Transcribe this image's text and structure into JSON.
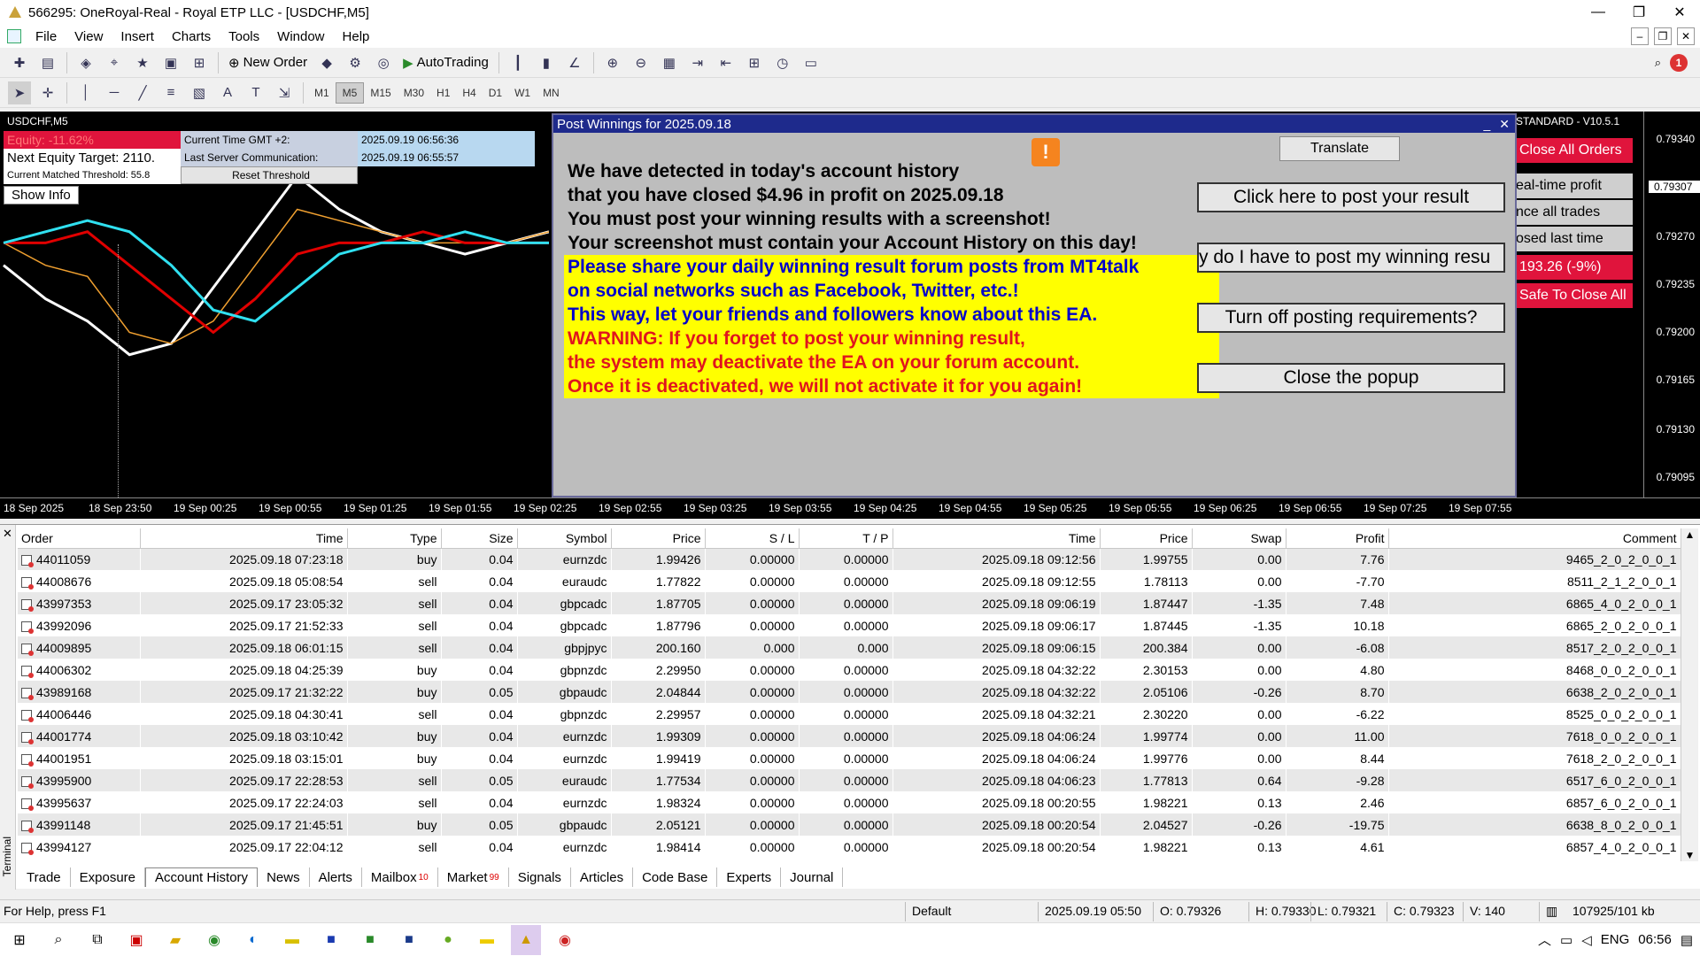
{
  "window": {
    "title": "566295: OneRoyal-Real - Royal ETP LLC - [USDCHF,M5]"
  },
  "menu": [
    "File",
    "View",
    "Insert",
    "Charts",
    "Tools",
    "Window",
    "Help"
  ],
  "toolbar": {
    "new_order": "New Order",
    "autotrading": "AutoTrading",
    "notif_count": "1"
  },
  "timeframes": [
    {
      "label": "M1",
      "active": false
    },
    {
      "label": "M5",
      "active": true
    },
    {
      "label": "M15",
      "active": false
    },
    {
      "label": "M30",
      "active": false
    },
    {
      "label": "H1",
      "active": false
    },
    {
      "label": "H4",
      "active": false
    },
    {
      "label": "D1",
      "active": false
    },
    {
      "label": "W1",
      "active": false
    },
    {
      "label": "MN",
      "active": false
    }
  ],
  "chart": {
    "symbol_label": "USDCHF,M5",
    "price_ticks": [
      "0.79340",
      "0.79270",
      "0.79235",
      "0.79200",
      "0.79165",
      "0.79130",
      "0.79095"
    ],
    "current_price": "0.79307",
    "time_ticks": [
      "18 Sep 2025",
      "18 Sep 23:50",
      "19 Sep 00:25",
      "19 Sep 00:55",
      "19 Sep 01:25",
      "19 Sep 01:55",
      "19 Sep 02:25",
      "19 Sep 02:55",
      "19 Sep 03:25",
      "19 Sep 03:55",
      "19 Sep 04:25",
      "19 Sep 04:55",
      "19 Sep 05:25",
      "19 Sep 05:55",
      "19 Sep 06:25",
      "19 Sep 06:55",
      "19 Sep 07:25",
      "19 Sep 07:55"
    ]
  },
  "info_panel": {
    "equity": "Equity: -11.62%",
    "next_target": "Next Equity Target: 2110.",
    "threshold": "Current Matched Threshold: 55.8",
    "gmt_label": "Current Time GMT +2:",
    "gmt_value": "2025.09.19 06:56:36",
    "server_label": "Last Server Communication:",
    "server_value": "2025.09.19 06:55:57",
    "reset": "Reset Threshold",
    "show_info": "Show Info"
  },
  "ea_panel": {
    "title": "STANDARD - V10.5.1",
    "close_all": "Close All Orders",
    "realtime": "eal-time profit",
    "balance": "nce all trades",
    "closed": "osed last time",
    "pnl": "193.26 (-9%)",
    "safe": "Safe To Close All"
  },
  "popup": {
    "title": "Post Winnings for 2025.09.18",
    "translate": "Translate",
    "lines": [
      {
        "text": "We have detected in today's account history",
        "style": "plain"
      },
      {
        "text": "that you have closed $4.96 in profit on 2025.09.18",
        "style": "plain"
      },
      {
        "text": "You must post your winning results with a screenshot!",
        "style": "plain"
      },
      {
        "text": "Your screenshot must contain your Account History on this day!",
        "style": "plain"
      },
      {
        "text": "Please share your daily winning result forum posts from MT4talk",
        "style": "yb"
      },
      {
        "text": "on social networks such as Facebook, Twitter, etc.!",
        "style": "yb"
      },
      {
        "text": "This way, let your friends and followers know about this EA.",
        "style": "yb"
      },
      {
        "text": "WARNING: If you forget to post your winning result,",
        "style": "yr"
      },
      {
        "text": "the system may deactivate the EA on your forum account.",
        "style": "yr"
      },
      {
        "text": "Once it is deactivated, we will not activate it for you again!",
        "style": "yr"
      }
    ],
    "buttons": {
      "post": "Click here to post your result",
      "why": "y do I have to post my winning resu",
      "turn_off": "Turn off posting requirements?",
      "close": "Close the popup"
    }
  },
  "terminal": {
    "side_label": "Terminal",
    "columns": [
      "Order",
      "Time",
      "Type",
      "Size",
      "Symbol",
      "Price",
      "S / L",
      "T / P",
      "Time",
      "Price",
      "Swap",
      "Profit",
      "Comment"
    ],
    "rows": [
      [
        "44011059",
        "2025.09.18 07:23:18",
        "buy",
        "0.04",
        "eurnzdc",
        "1.99426",
        "0.00000",
        "0.00000",
        "2025.09.18 09:12:56",
        "1.99755",
        "0.00",
        "7.76",
        "9465_2_0_2_0_0_1"
      ],
      [
        "44008676",
        "2025.09.18 05:08:54",
        "sell",
        "0.04",
        "euraudc",
        "1.77822",
        "0.00000",
        "0.00000",
        "2025.09.18 09:12:55",
        "1.78113",
        "0.00",
        "-7.70",
        "8511_2_1_2_0_0_1"
      ],
      [
        "43997353",
        "2025.09.17 23:05:32",
        "sell",
        "0.04",
        "gbpcadc",
        "1.87705",
        "0.00000",
        "0.00000",
        "2025.09.18 09:06:19",
        "1.87447",
        "-1.35",
        "7.48",
        "6865_4_0_2_0_0_1"
      ],
      [
        "43992096",
        "2025.09.17 21:52:33",
        "sell",
        "0.04",
        "gbpcadc",
        "1.87796",
        "0.00000",
        "0.00000",
        "2025.09.18 09:06:17",
        "1.87445",
        "-1.35",
        "10.18",
        "6865_2_0_2_0_0_1"
      ],
      [
        "44009895",
        "2025.09.18 06:01:15",
        "sell",
        "0.04",
        "gbpjpyc",
        "200.160",
        "0.000",
        "0.000",
        "2025.09.18 09:06:15",
        "200.384",
        "0.00",
        "-6.08",
        "8517_2_0_2_0_0_1"
      ],
      [
        "44006302",
        "2025.09.18 04:25:39",
        "buy",
        "0.04",
        "gbpnzdc",
        "2.29950",
        "0.00000",
        "0.00000",
        "2025.09.18 04:32:22",
        "2.30153",
        "0.00",
        "4.80",
        "8468_0_0_2_0_0_1"
      ],
      [
        "43989168",
        "2025.09.17 21:32:22",
        "buy",
        "0.05",
        "gbpaudc",
        "2.04844",
        "0.00000",
        "0.00000",
        "2025.09.18 04:32:22",
        "2.05106",
        "-0.26",
        "8.70",
        "6638_2_0_2_0_0_1"
      ],
      [
        "44006446",
        "2025.09.18 04:30:41",
        "sell",
        "0.04",
        "gbpnzdc",
        "2.29957",
        "0.00000",
        "0.00000",
        "2025.09.18 04:32:21",
        "2.30220",
        "0.00",
        "-6.22",
        "8525_0_0_2_0_0_1"
      ],
      [
        "44001774",
        "2025.09.18 03:10:42",
        "buy",
        "0.04",
        "eurnzdc",
        "1.99309",
        "0.00000",
        "0.00000",
        "2025.09.18 04:06:24",
        "1.99774",
        "0.00",
        "11.00",
        "7618_0_0_2_0_0_1"
      ],
      [
        "44001951",
        "2025.09.18 03:15:01",
        "buy",
        "0.04",
        "eurnzdc",
        "1.99419",
        "0.00000",
        "0.00000",
        "2025.09.18 04:06:24",
        "1.99776",
        "0.00",
        "8.44",
        "7618_2_0_2_0_0_1"
      ],
      [
        "43995900",
        "2025.09.17 22:28:53",
        "sell",
        "0.05",
        "euraudc",
        "1.77534",
        "0.00000",
        "0.00000",
        "2025.09.18 04:06:23",
        "1.77813",
        "0.64",
        "-9.28",
        "6517_6_0_2_0_0_1"
      ],
      [
        "43995637",
        "2025.09.17 22:24:03",
        "sell",
        "0.04",
        "eurnzdc",
        "1.98324",
        "0.00000",
        "0.00000",
        "2025.09.18 00:20:55",
        "1.98221",
        "0.13",
        "2.46",
        "6857_6_0_2_0_0_1"
      ],
      [
        "43991148",
        "2025.09.17 21:45:51",
        "buy",
        "0.05",
        "gbpaudc",
        "2.05121",
        "0.00000",
        "0.00000",
        "2025.09.18 00:20:54",
        "2.04527",
        "-0.26",
        "-19.75",
        "6638_8_0_2_0_0_1"
      ],
      [
        "43994127",
        "2025.09.17 22:04:12",
        "sell",
        "0.04",
        "eurnzdc",
        "1.98414",
        "0.00000",
        "0.00000",
        "2025.09.18 00:20:54",
        "1.98221",
        "0.13",
        "4.61",
        "6857_4_0_2_0_0_1"
      ]
    ],
    "tabs": [
      {
        "label": "Trade",
        "badge": "",
        "active": false
      },
      {
        "label": "Exposure",
        "badge": "",
        "active": false
      },
      {
        "label": "Account History",
        "badge": "",
        "active": true
      },
      {
        "label": "News",
        "badge": "",
        "active": false
      },
      {
        "label": "Alerts",
        "badge": "",
        "active": false
      },
      {
        "label": "Mailbox",
        "badge": "10",
        "active": false
      },
      {
        "label": "Market",
        "badge": "99",
        "active": false
      },
      {
        "label": "Signals",
        "badge": "",
        "active": false
      },
      {
        "label": "Articles",
        "badge": "",
        "active": false
      },
      {
        "label": "Code Base",
        "badge": "",
        "active": false
      },
      {
        "label": "Experts",
        "badge": "",
        "active": false
      },
      {
        "label": "Journal",
        "badge": "",
        "active": false
      }
    ]
  },
  "status": {
    "help": "For Help, press F1",
    "profile": "Default",
    "time": "2025.09.19 05:50",
    "open": "O: 0.79326",
    "high": "H: 0.79330",
    "low": "L: 0.79321",
    "close": "C: 0.79323",
    "volume": "V: 140",
    "traffic": "107925/101 kb"
  },
  "taskbar": {
    "lang": "ENG",
    "clock": "06:56"
  },
  "series": {
    "white": [
      0.7924,
      0.7921,
      0.7919,
      0.7916,
      0.7917,
      0.7922,
      0.7927,
      0.7932,
      0.7929,
      0.7927,
      0.7926,
      0.7925,
      0.7926,
      0.7927
    ],
    "orange": [
      0.7926,
      0.7924,
      0.7923,
      0.7918,
      0.7917,
      0.7919,
      0.7924,
      0.7929,
      0.7928,
      0.7927,
      0.7926,
      0.7926,
      0.7926,
      0.7927
    ],
    "red": [
      0.7926,
      0.7926,
      0.7927,
      0.7924,
      0.7921,
      0.7918,
      0.7921,
      0.7925,
      0.7926,
      0.7926,
      0.7927,
      0.7926,
      0.7926,
      0.7926
    ],
    "cyan": [
      0.7926,
      0.7927,
      0.7928,
      0.7927,
      0.7924,
      0.792,
      0.7919,
      0.7922,
      0.7925,
      0.7926,
      0.7926,
      0.7927,
      0.7926,
      0.7926
    ]
  },
  "colors": {
    "white": "#ffffff",
    "orange": "#f0a030",
    "red": "#e00000",
    "cyan": "#30e0f0"
  }
}
